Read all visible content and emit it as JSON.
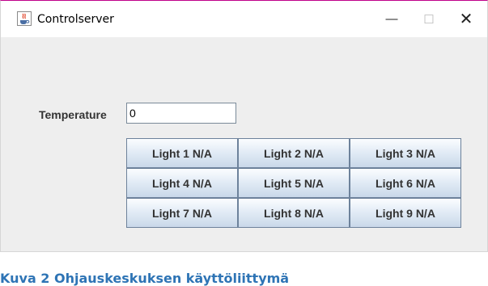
{
  "window": {
    "title": "Controlserver",
    "controls": {
      "minimize": "—",
      "maximize": "☐",
      "close": "✕"
    }
  },
  "form": {
    "temperature_label": "Temperature",
    "temperature_value": "0"
  },
  "lights": [
    "Light 1 N/A",
    "Light 2 N/A",
    "Light 3 N/A",
    "Light 4 N/A",
    "Light 5 N/A",
    "Light 6 N/A",
    "Light 7 N/A",
    "Light 8 N/A",
    "Light 9 N/A"
  ],
  "caption": "Kuva 2 Ohjauskeskuksen käyttöliittymä",
  "icons": {
    "app": "java-cup-icon"
  },
  "colors": {
    "title_border": "#c0008a",
    "caption": "#2e74b5"
  }
}
